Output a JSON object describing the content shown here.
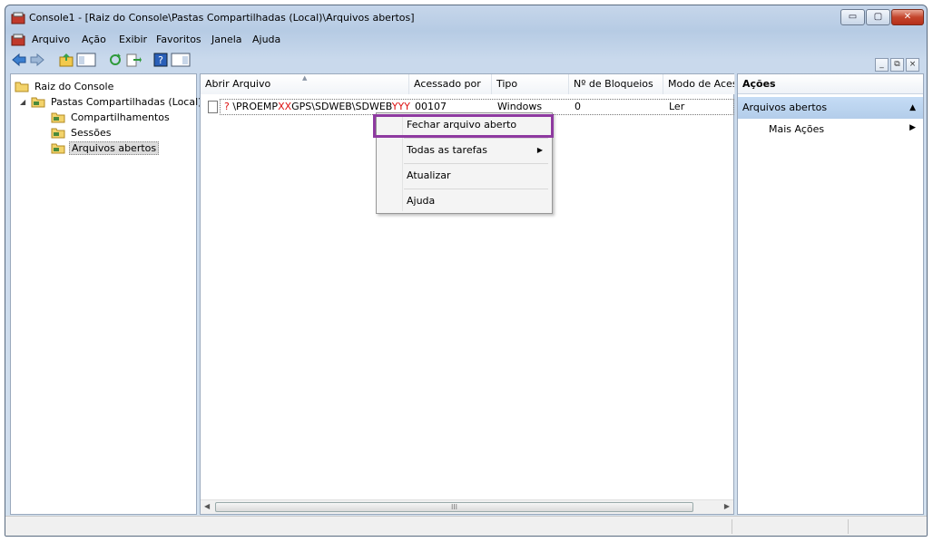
{
  "window": {
    "title": "Console1 - [Raiz do Console\\Pastas Compartilhadas (Local)\\Arquivos abertos]",
    "controls": {
      "minimize": "▭",
      "maximize": "▢",
      "close": "✕"
    }
  },
  "menubar": {
    "items": [
      {
        "label": "Arquivo"
      },
      {
        "label": "Ação"
      },
      {
        "label": "Exibir"
      },
      {
        "label": "Favoritos"
      },
      {
        "label": "Janela"
      },
      {
        "label": "Ajuda"
      }
    ],
    "mdi_controls": {
      "minimize": "_",
      "restore": "⧉",
      "close": "×"
    }
  },
  "toolbar": {
    "buttons": [
      "back-icon",
      "forward-icon",
      "up-folder-icon",
      "show-hide-tree-icon",
      "refresh-icon",
      "export-list-icon",
      "help-icon",
      "show-hide-action-pane-icon"
    ]
  },
  "tree": {
    "root": "Raiz do Console",
    "shared_folders": "Pastas Compartilhadas (Local)",
    "children": [
      {
        "label": "Compartilhamentos"
      },
      {
        "label": "Sessões"
      },
      {
        "label": "Arquivos abertos",
        "selected": true
      }
    ]
  },
  "list": {
    "columns": [
      "Abrir Arquivo",
      "Acessado por",
      "Tipo",
      "Nº de Bloqueios",
      "Modo de Aces"
    ],
    "rows": [
      {
        "path_prefix": "\\PROEMP",
        "path_red1": "XX",
        "path_middle": "GPS\\SDWEB\\SDWEB",
        "path_red2": "YYYY",
        "accessed_by": "00107",
        "type": "Windows",
        "locks": "0",
        "mode": "Ler",
        "question_mark": "?"
      }
    ],
    "scroll_grip": "III"
  },
  "context_menu": {
    "items": [
      {
        "label": "Fechar arquivo aberto",
        "highlighted": true
      },
      {
        "label": "Todas as tarefas",
        "submenu": true
      },
      {
        "label": "Atualizar"
      },
      {
        "label": "Ajuda"
      }
    ],
    "submenu_arrow": "▶"
  },
  "actions": {
    "header": "Ações",
    "group": "Arquivos abertos",
    "group_caret": "▲",
    "item": "Mais Ações",
    "item_arrow": "▶"
  },
  "colors": {
    "highlight_border": "#8e3aa0",
    "red_text": "#dd1111",
    "selection_blue": "#b3cdea"
  }
}
